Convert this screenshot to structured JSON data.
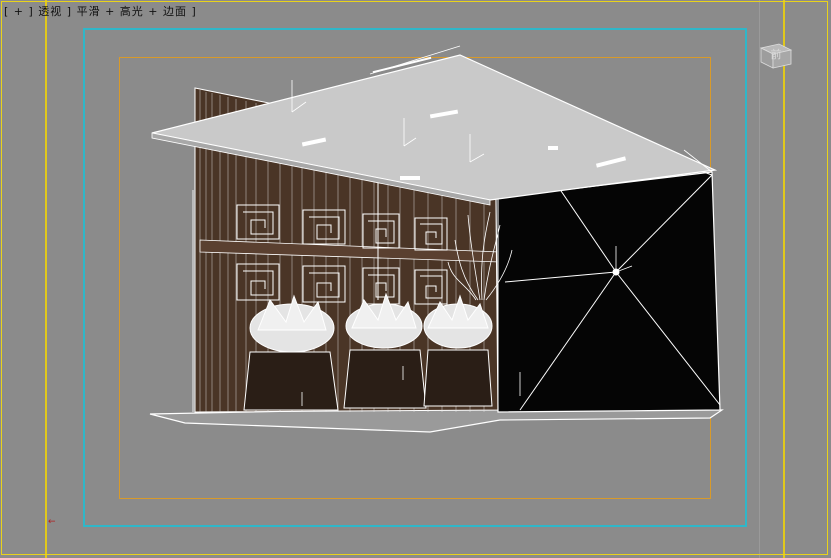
{
  "viewport": {
    "label": "[ + ] 透视 ] 平滑 + 高光 + 边面 ]",
    "viewcube_label": "前",
    "colors": {
      "background": "#8b8b8b",
      "frame_yellow": "#e8d21c",
      "safe_frame_cyan": "#2fb7c9",
      "safe_frame_orange": "#d89a2a",
      "wood": "#4a3526",
      "ceiling": "#c9c9c9",
      "dark_wall": "#050505",
      "wire": "#ffffff"
    }
  },
  "scene": {
    "label": "3d-interior-scene"
  }
}
